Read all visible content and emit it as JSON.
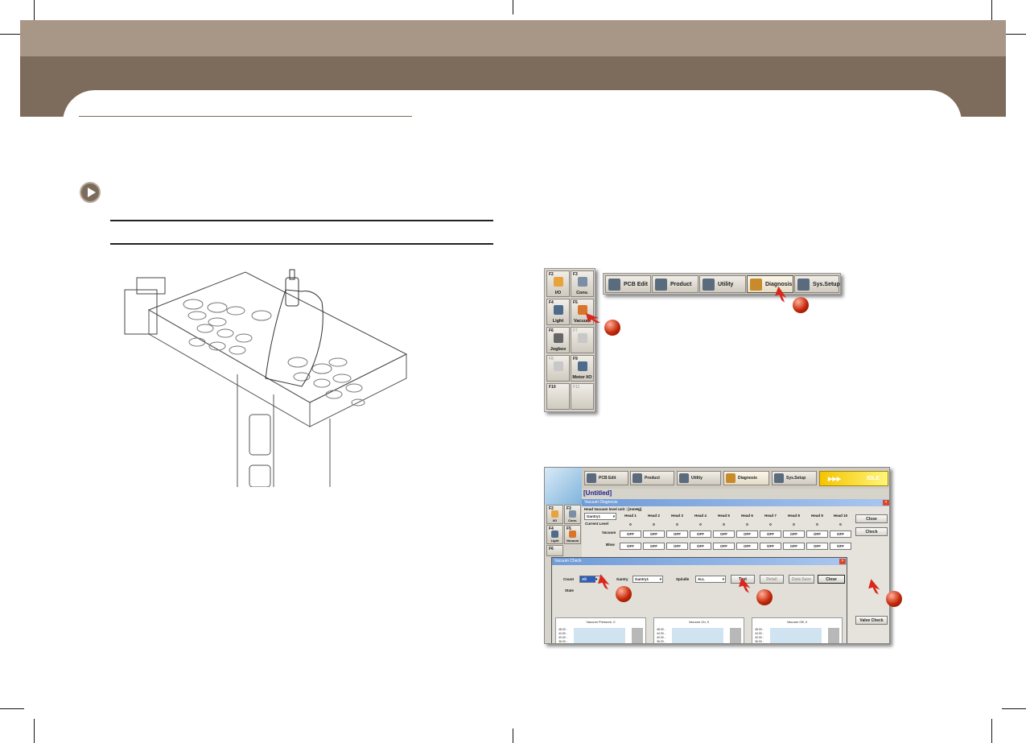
{
  "function_keys": [
    {
      "key": "F2",
      "label": "I/O",
      "dim": false
    },
    {
      "key": "F3",
      "label": "Conv.",
      "dim": false
    },
    {
      "key": "F4",
      "label": "Light",
      "dim": false
    },
    {
      "key": "F5",
      "label": "Vacuum",
      "dim": false
    },
    {
      "key": "F6",
      "label": "Jogbox",
      "dim": false
    },
    {
      "key": "F7",
      "label": "",
      "dim": true
    },
    {
      "key": "F8",
      "label": "",
      "dim": true
    },
    {
      "key": "F9",
      "label": "Motor I/O",
      "dim": false
    },
    {
      "key": "F10",
      "label": "",
      "dim": false
    },
    {
      "key": "F11",
      "label": "",
      "dim": true
    }
  ],
  "menu": {
    "pcb_edit": "PCB Edit",
    "product": "Product",
    "utility": "Utility",
    "diagnosis": "Diagnosis",
    "sys_setup": "Sys.Setup"
  },
  "window": {
    "idle_arrows": "▶▶▶",
    "idle_label": "IDLE",
    "doc_title": "[Untitled]",
    "mini_keys": [
      {
        "key": "F2",
        "label": "I/O"
      },
      {
        "key": "F3",
        "label": "Conv."
      },
      {
        "key": "F4",
        "label": "Light"
      },
      {
        "key": "F5",
        "label": "Vacuum"
      },
      {
        "key": "F6",
        "label": ""
      }
    ]
  },
  "vacuum_diagnosis": {
    "title": "Vacuum Diagnosis",
    "unit_label": "Head Vacuum level   unit : [mmHg]",
    "gantry_select": "Gantry1",
    "heads": [
      "Head 1",
      "Head 2",
      "Head 3",
      "Head 4",
      "Head 5",
      "Head 6",
      "Head 7",
      "Head 8",
      "Head 9",
      "Head 10"
    ],
    "current_level_label": "Current Level",
    "current_level": [
      "0",
      "0",
      "0",
      "0",
      "0",
      "0",
      "0",
      "0",
      "0",
      "0"
    ],
    "vacuum_label": "Vacuum",
    "vacuum": [
      "OFF",
      "OFF",
      "OFF",
      "OFF",
      "OFF",
      "OFF",
      "OFF",
      "OFF",
      "OFF",
      "OFF"
    ],
    "blow_label": "Blow",
    "blow": [
      "OFF",
      "OFF",
      "OFF",
      "OFF",
      "OFF",
      "OFF",
      "OFF",
      "OFF",
      "OFF",
      "OFF"
    ],
    "close_label": "Close",
    "check_label": "Check",
    "valve_check_label": "Valve Check",
    "close_icon": "x-icon"
  },
  "vacuum_check": {
    "title": "Vacuum Check",
    "count_label": "Count",
    "count_value": "All",
    "gantry_label": "Gantry",
    "gantry_value": "Gantry1",
    "spindle_label": "Spindle",
    "spindle_value": "ALL",
    "test_label": "Test",
    "detail_label": "Detail",
    "data_save_label": "Data Save",
    "close_label": "Close",
    "state_label": "State",
    "graphs": [
      {
        "title": "Vacuum Pressure, 0",
        "ticks": [
          "48.00 -",
          "44.00 -",
          "40.00 -",
          "36.00 -"
        ]
      },
      {
        "title": "Vacuum On, 0",
        "ticks": [
          "48.00 -",
          "44.00 -",
          "40.00 -",
          "36.00 -"
        ]
      },
      {
        "title": "Vacuum Off, 0",
        "ticks": [
          "48.00 -",
          "44.00 -",
          "40.00 -",
          "36.00 -"
        ]
      }
    ]
  },
  "colors": {
    "header_light": "#a89787",
    "header_dark": "#7d6b5c",
    "marker": "#c5290a",
    "idle": "#f5c400"
  }
}
